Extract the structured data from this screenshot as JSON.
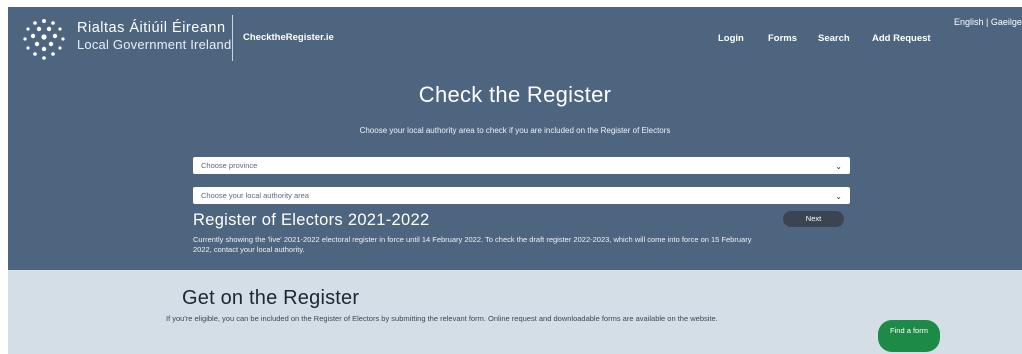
{
  "header": {
    "gov_title": "Rialtas Áitiúil Éireann",
    "gov_subtitle": "Local Government Ireland",
    "site_name": "ChecktheRegister.ie",
    "nav": {
      "login": "Login",
      "forms": "Forms",
      "search": "Search",
      "add_request": "Add Request"
    },
    "language": {
      "english": "English",
      "separator": " | ",
      "irish": "Gaeilge"
    }
  },
  "hero": {
    "title": "Check the Register",
    "subtitle": "Choose your local authority area to check if you are included on the Register of Electors",
    "province_select": "Choose province",
    "authority_select": "Choose your local authority area",
    "register_heading": "Register of Electors 2021-2022",
    "next_label": "Next",
    "note": "Currently showing the 'live' 2021-2022 electoral register in force until 14 February 2022. To check the draft register 2022-2023, which will come into force on 15 February 2022, contact your local authority."
  },
  "get_on": {
    "title": "Get on the Register",
    "text": "If you're eligible, you can be included on the Register of Electors by submitting the relevant form. Online request and downloadable forms are available on the website.",
    "button_label": "Find a form"
  },
  "colors": {
    "hero_bg": "#4e6580",
    "band_bg": "#d3dee7",
    "next_button": "#3b4450",
    "find_button": "#1d8a47"
  }
}
